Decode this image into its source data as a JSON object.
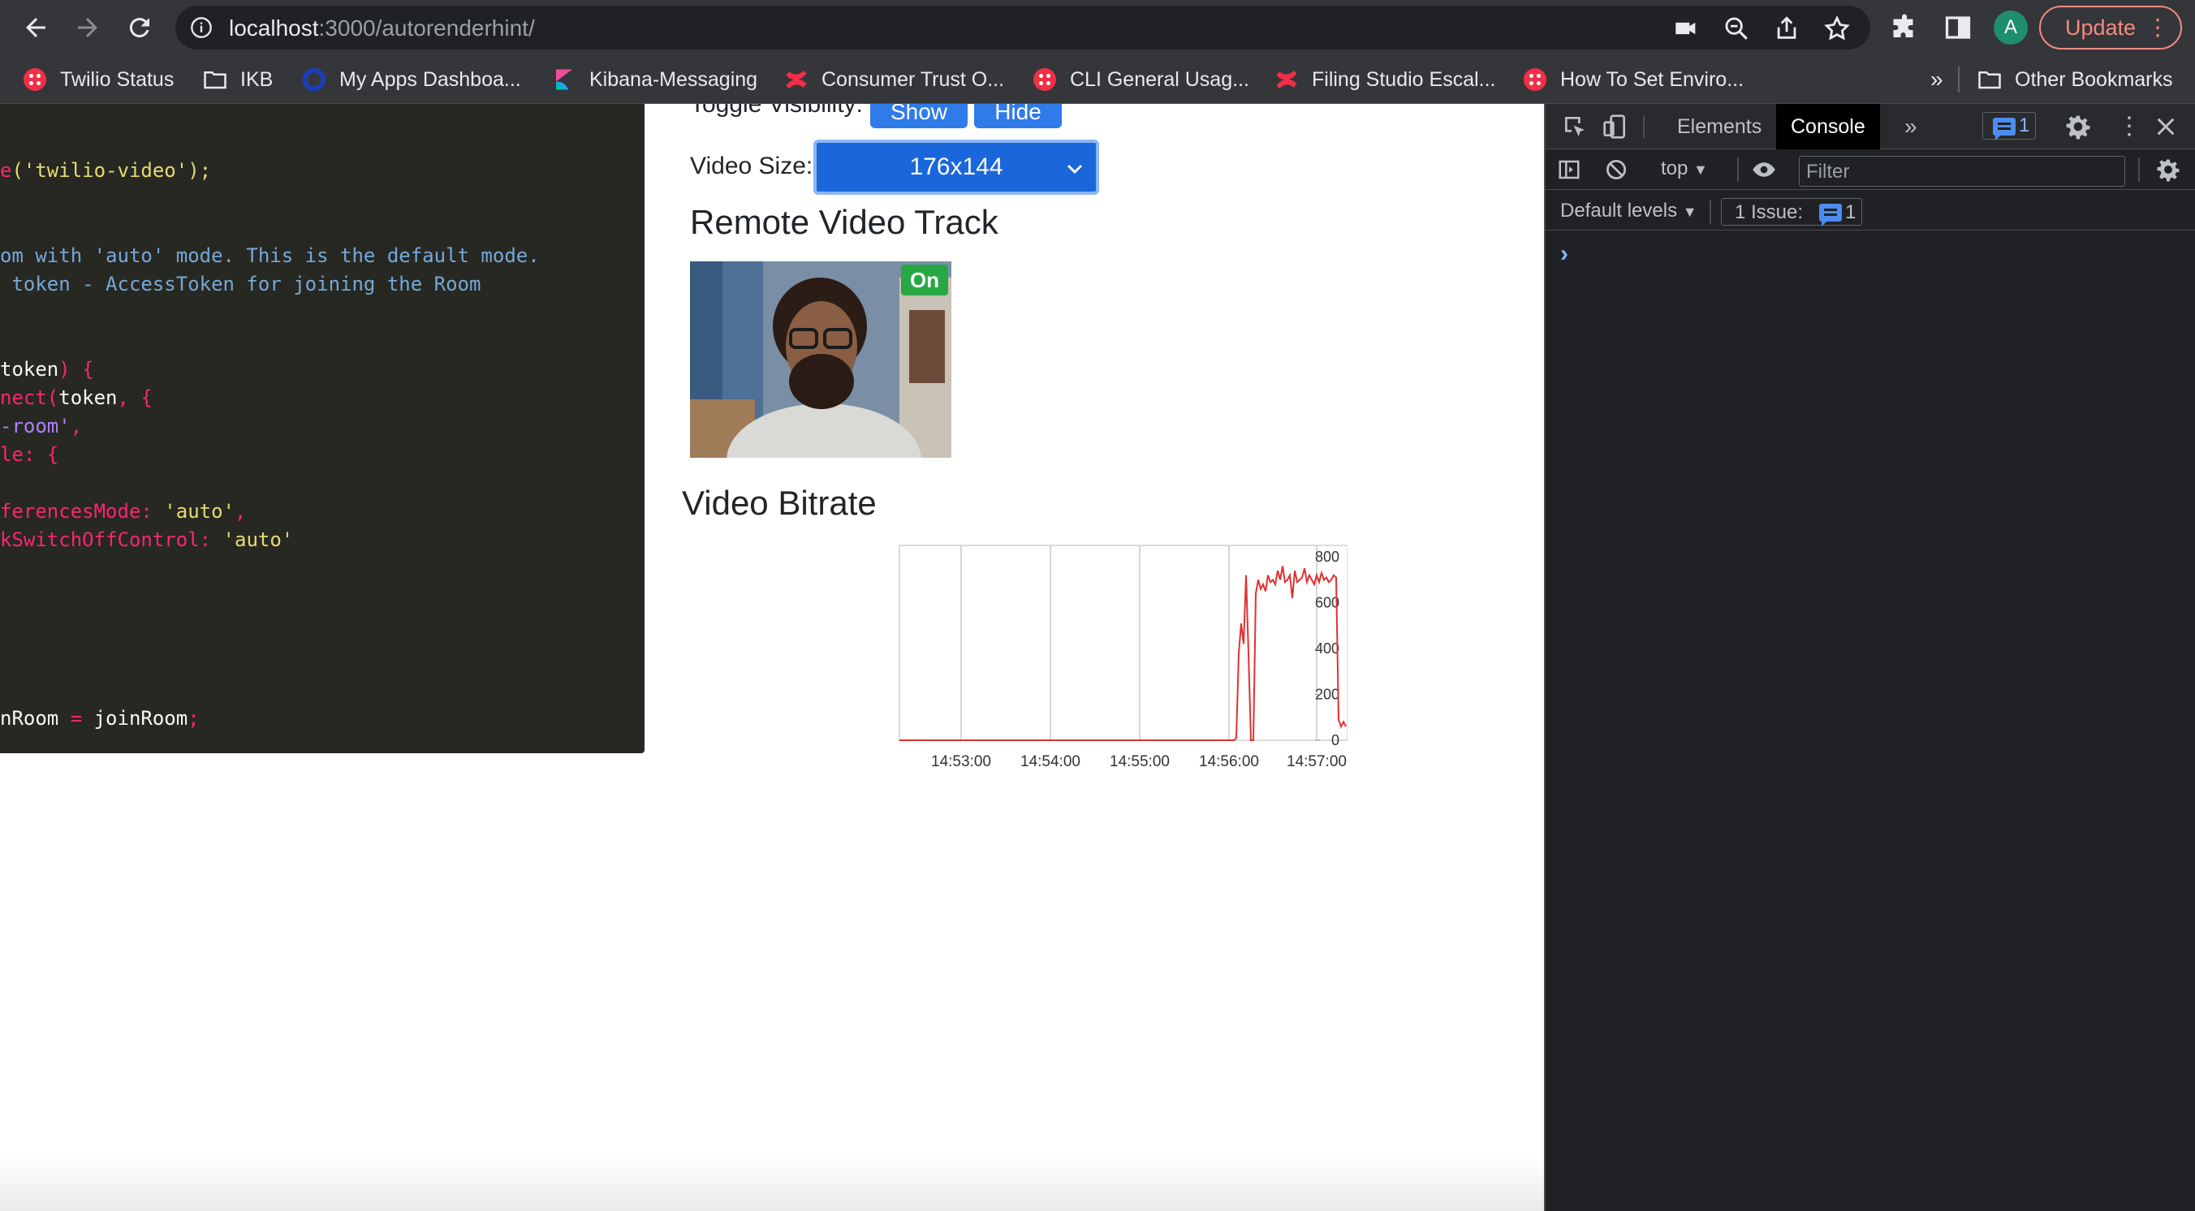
{
  "browser": {
    "url_host": "localhost",
    "url_path": ":3000/autorenderhint/",
    "update_label": "Update",
    "avatar_letter": "A"
  },
  "bookmarks": [
    {
      "label": "Twilio Status",
      "icon": "twilio-icon"
    },
    {
      "label": "IKB",
      "icon": "folder-icon"
    },
    {
      "label": "My Apps Dashboa...",
      "icon": "okta-icon"
    },
    {
      "label": "Kibana-Messaging",
      "icon": "kibana-icon"
    },
    {
      "label": "Consumer Trust O...",
      "icon": "confluence-icon"
    },
    {
      "label": "CLI General Usag...",
      "icon": "twilio-icon"
    },
    {
      "label": "Filing Studio Escal...",
      "icon": "confluence-icon"
    },
    {
      "label": "How To Set Enviro...",
      "icon": "twilio-icon"
    }
  ],
  "bookmarks_more": "»",
  "other_bookmarks": "Other Bookmarks",
  "code": {
    "l1_str": "('twilio-video');",
    "l1_pre": "e",
    "l2": "om with 'auto' mode. This is the default mode.",
    "l3": " token - AccessToken for joining the Room",
    "l4_a": "token",
    "l4_b": ") {",
    "l5_a": "nect",
    "l5_b": "(",
    "l5_c": "token",
    "l5_d": ", {",
    "l6": "-room'",
    "l6_b": ",",
    "l7": "le: {",
    "l8_a": "ferencesMode: ",
    "l8_b": "'auto'",
    "l8_c": ",",
    "l9_a": "kSwitchOffControl: ",
    "l9_b": "'auto'",
    "l10_a": "nRoom ",
    "l10_b": "= ",
    "l10_c": "joinRoom",
    "l10_d": ";"
  },
  "controls": {
    "toggle_label": "Toggle Visibility:",
    "show_label": "Show",
    "hide_label": "Hide",
    "size_label": "Video Size:",
    "size_value": "176x144"
  },
  "remote_heading": "Remote Video Track",
  "on_badge": "On",
  "bitrate_heading": "Video Bitrate",
  "chart_data": {
    "type": "line",
    "title": "",
    "xlabel": "",
    "ylabel": "",
    "x_ticks": [
      "14:53:00",
      "14:54:00",
      "14:55:00",
      "14:56:00",
      "14:57:00"
    ],
    "y_ticks": [
      0,
      200,
      400,
      600,
      800
    ],
    "ylim": [
      0,
      850
    ],
    "x_range_minutes": [
      14.52,
      15.2
    ],
    "series": [
      {
        "color": "#e03131",
        "x": [
          14.52,
          15.0,
          15.05,
          15.08,
          15.1,
          15.12,
          15.14,
          15.16,
          15.18,
          15.2,
          15.22,
          15.24,
          15.26,
          15.28,
          15.3,
          15.32,
          15.34,
          15.36,
          15.38,
          15.4,
          15.42,
          15.44,
          15.46,
          15.48,
          15.5,
          15.52,
          15.54,
          15.56,
          15.58,
          15.6,
          15.62,
          15.64,
          15.66,
          15.68,
          15.7,
          15.72,
          15.74,
          15.76,
          15.78,
          15.8,
          15.82,
          15.84,
          15.86,
          15.88,
          15.9,
          15.92,
          15.94,
          15.96,
          15.98,
          16.0
        ],
        "y": [
          0,
          0,
          0,
          0,
          10,
          380,
          510,
          420,
          720,
          380,
          0,
          0,
          640,
          700,
          660,
          680,
          650,
          720,
          690,
          700,
          680,
          740,
          700,
          760,
          690,
          700,
          720,
          620,
          740,
          690,
          700,
          710,
          750,
          690,
          720,
          700,
          680,
          720,
          690,
          730,
          700,
          710,
          690,
          700,
          720,
          710,
          90,
          60,
          80,
          60
        ]
      }
    ]
  },
  "devtools": {
    "tab_elements": "Elements",
    "tab_console": "Console",
    "tabs_more": "»",
    "msg_count": "1",
    "context": "top",
    "filter_placeholder": "Filter",
    "levels": "Default levels",
    "issues_label": "1 Issue:",
    "issues_count": "1",
    "prompt": "›"
  }
}
